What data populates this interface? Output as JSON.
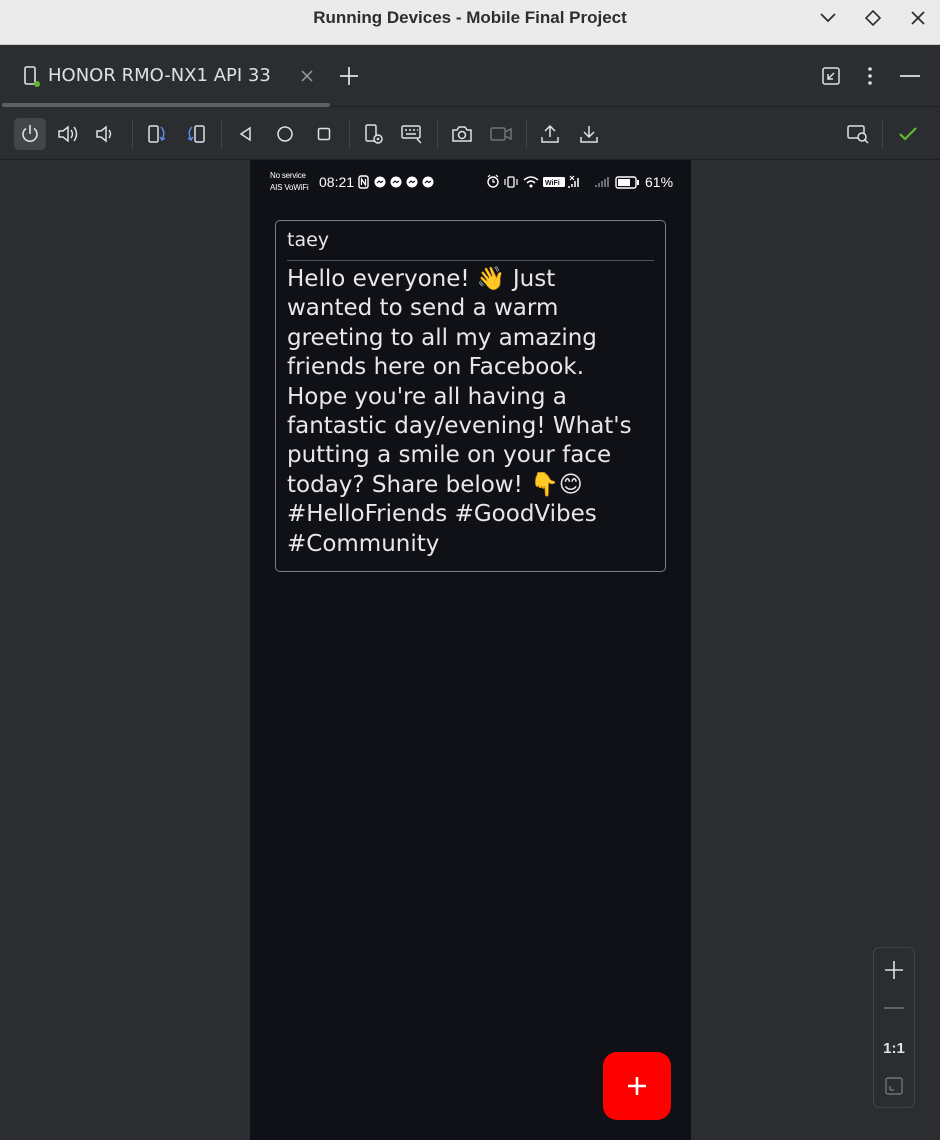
{
  "window": {
    "title": "Running Devices - Mobile Final Project"
  },
  "tab": {
    "label": "HONOR RMO-NX1 API 33",
    "status_color": "#5fb832"
  },
  "toolbar": {
    "buttons": [
      "power-icon",
      "volume-up-icon",
      "volume-down-icon",
      "rotate-left-icon",
      "rotate-right-icon",
      "back-icon",
      "home-icon",
      "overview-icon",
      "device-settings-icon",
      "keyboard-icon",
      "screenshot-icon",
      "screen-record-icon",
      "upload-icon",
      "download-icon"
    ],
    "right_buttons": [
      "inspect-icon",
      "check-icon"
    ],
    "check_color": "#5fb832"
  },
  "device": {
    "status_bar": {
      "carrier_line1": "No service",
      "carrier_line2": "AIS VoWiFi",
      "time": "08:21",
      "battery": "61%"
    },
    "post": {
      "author": "taey",
      "text": "Hello everyone! 👋 Just\nwanted to send a warm\ngreeting to all my amazing\nfriends here on Facebook.\nHope you're all having a\nfantastic day/evening! What's\nputting a smile on your face\ntoday? Share below! 👇😊\n#HelloFriends #GoodVibes\n#Community"
    },
    "fab": {
      "label": "+",
      "color": "#ff0000"
    }
  },
  "zoom": {
    "ratio_label": "1:1"
  }
}
